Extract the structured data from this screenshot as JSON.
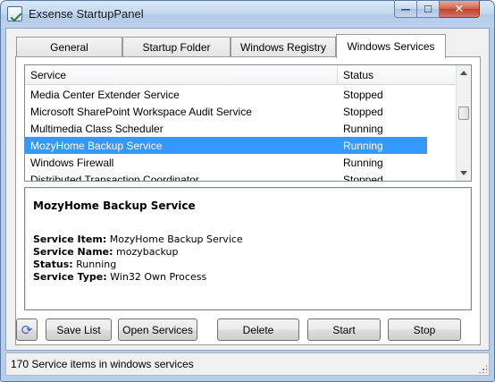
{
  "window": {
    "title": "Exsense StartupPanel",
    "caption_buttons": {
      "minimize": "—",
      "maximize": "☐",
      "close": "✕"
    }
  },
  "tabs": [
    {
      "label": "General"
    },
    {
      "label": "Startup Folder"
    },
    {
      "label": "Windows Registry"
    },
    {
      "label": "Windows Services",
      "active": true
    }
  ],
  "service_list": {
    "columns": [
      "Service",
      "Status"
    ],
    "rows": [
      {
        "service": "Media Center Extender Service",
        "status": "Stopped"
      },
      {
        "service": "Microsoft SharePoint Workspace Audit Service",
        "status": "Stopped"
      },
      {
        "service": "Multimedia Class Scheduler",
        "status": "Running"
      },
      {
        "service": "MozyHome Backup Service",
        "status": "Running",
        "selected": true
      },
      {
        "service": "Windows Firewall",
        "status": "Running"
      },
      {
        "service": "Distributed Transaction Coordinator",
        "status": "Stopped"
      }
    ]
  },
  "details": {
    "title": "MozyHome Backup Service",
    "fields": [
      {
        "label": "Service Item:",
        "value": "MozyHome Backup Service"
      },
      {
        "label": "Service Name:",
        "value": "mozybackup"
      },
      {
        "label": "Status:",
        "value": "Running"
      },
      {
        "label": "Service Type:",
        "value": "Win32 Own Process"
      }
    ]
  },
  "buttons": {
    "refresh_icon": "refresh-icon",
    "save_list": "Save List",
    "open_services": "Open Services",
    "delete": "Delete",
    "start": "Start",
    "stop": "Stop"
  },
  "status_bar": {
    "text": "170 Service items in windows services"
  },
  "colors": {
    "selection": "#3399ff",
    "refresh_icon": "#2f66c6"
  }
}
